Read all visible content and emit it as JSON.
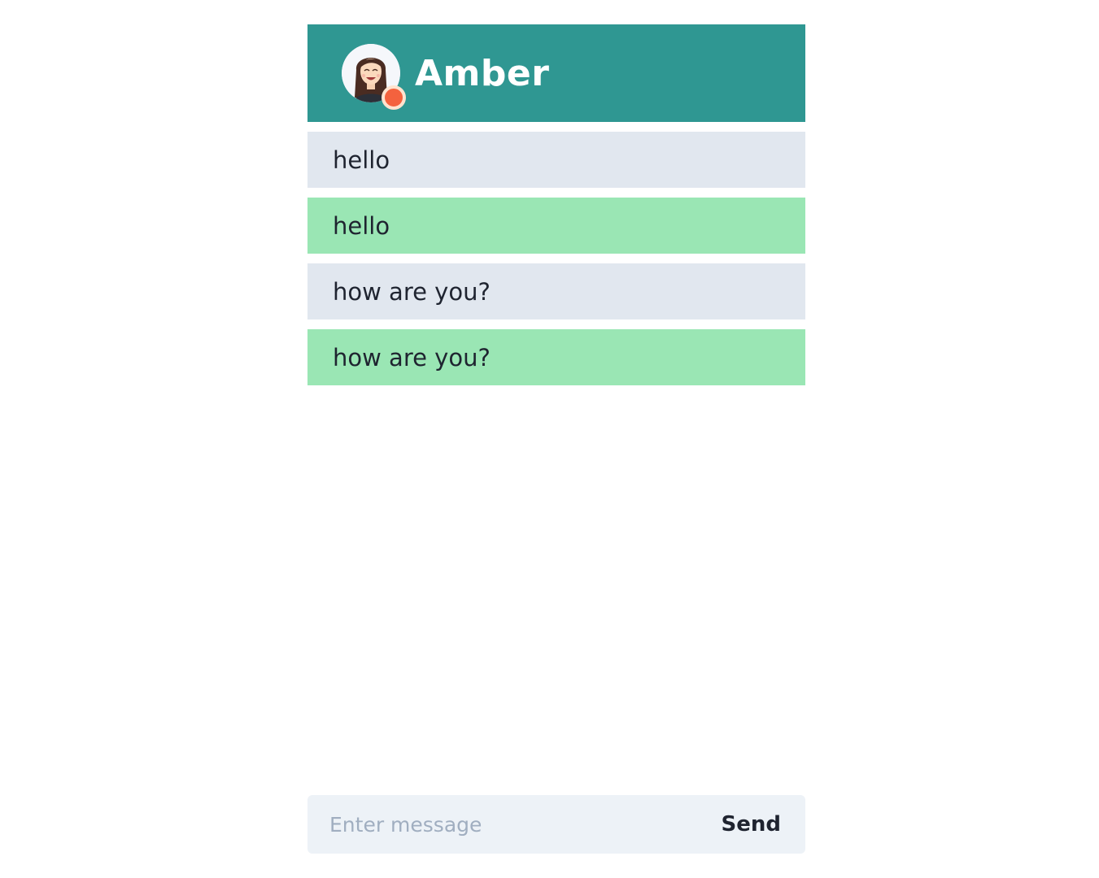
{
  "header": {
    "contact_name": "Amber",
    "avatar_icon": "woman-avatar-icon",
    "status_color": "#f4623e",
    "background_color": "#2f9792"
  },
  "messages": [
    {
      "text": "hello",
      "type": "received"
    },
    {
      "text": "hello",
      "type": "sent"
    },
    {
      "text": "how are you?",
      "type": "received"
    },
    {
      "text": "how are you?",
      "type": "sent"
    }
  ],
  "composer": {
    "placeholder": "Enter message",
    "value": "",
    "send_label": "Send"
  },
  "colors": {
    "received_bubble": "#e1e7ef",
    "sent_bubble": "#9ae6b4"
  }
}
